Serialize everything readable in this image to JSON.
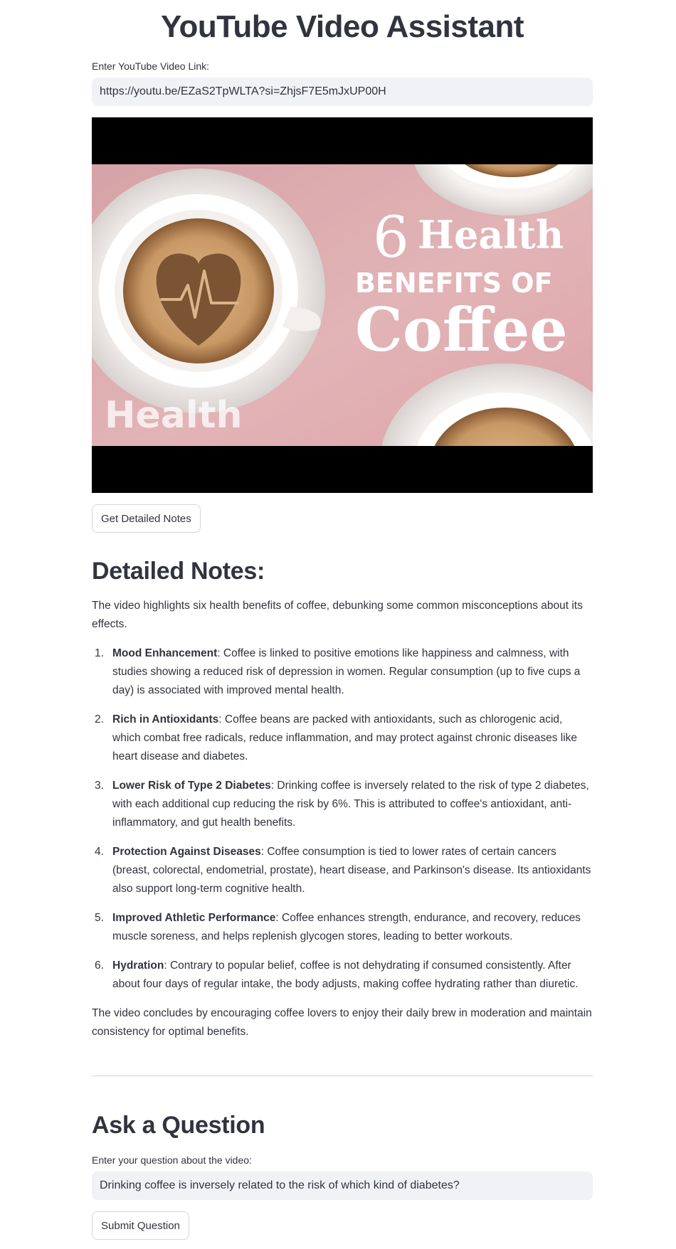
{
  "app": {
    "title": "YouTube Video Assistant"
  },
  "video_input": {
    "label": "Enter YouTube Video Link:",
    "value": "https://youtu.be/EZaS2TpWLTA?si=ZhjsF7E5mJxUP00H"
  },
  "thumbnail": {
    "title_number": "6",
    "title_word1": "Health",
    "title_line2": "BENEFITS OF",
    "title_line3": "Coffee",
    "brand": "Health",
    "icon": "heart-pulse-icon",
    "colors": {
      "background": "#e6b7ba",
      "saucer": "#f1eeec",
      "coffee": "#c89a6a",
      "heart": "#7a5433"
    }
  },
  "notes_button": {
    "label": "Get Detailed Notes"
  },
  "notes": {
    "heading": "Detailed Notes:",
    "intro": "The video highlights six health benefits of coffee, debunking some common misconceptions about its effects.",
    "items": [
      {
        "number": "1.",
        "title": "Mood Enhancement",
        "text": ": Coffee is linked to positive emotions like happiness and calmness, with studies showing a reduced risk of depression in women. Regular consumption (up to five cups a day) is associated with improved mental health."
      },
      {
        "number": "2.",
        "title": "Rich in Antioxidants",
        "text": ": Coffee beans are packed with antioxidants, such as chlorogenic acid, which combat free radicals, reduce inflammation, and may protect against chronic diseases like heart disease and diabetes."
      },
      {
        "number": "3.",
        "title": "Lower Risk of Type 2 Diabetes",
        "text": ": Drinking coffee is inversely related to the risk of type 2 diabetes, with each additional cup reducing the risk by 6%. This is attributed to coffee's antioxidant, anti-inflammatory, and gut health benefits."
      },
      {
        "number": "4.",
        "title": "Protection Against Diseases",
        "text": ": Coffee consumption is tied to lower rates of certain cancers (breast, colorectal, endometrial, prostate), heart disease, and Parkinson's disease. Its antioxidants also support long-term cognitive health."
      },
      {
        "number": "5.",
        "title": "Improved Athletic Performance",
        "text": ": Coffee enhances strength, endurance, and recovery, reduces muscle soreness, and helps replenish glycogen stores, leading to better workouts."
      },
      {
        "number": "6.",
        "title": "Hydration",
        "text": ": Contrary to popular belief, coffee is not dehydrating if consumed consistently. After about four days of regular intake, the body adjusts, making coffee hydrating rather than diuretic."
      }
    ],
    "conclusion": "The video concludes by encouraging coffee lovers to enjoy their daily brew in moderation and maintain consistency for optimal benefits."
  },
  "question": {
    "heading": "Ask a Question",
    "label": "Enter your question about the video:",
    "value": "Drinking coffee is inversely related to the risk of which kind of diabetes?",
    "submit_label": "Submit Question"
  }
}
